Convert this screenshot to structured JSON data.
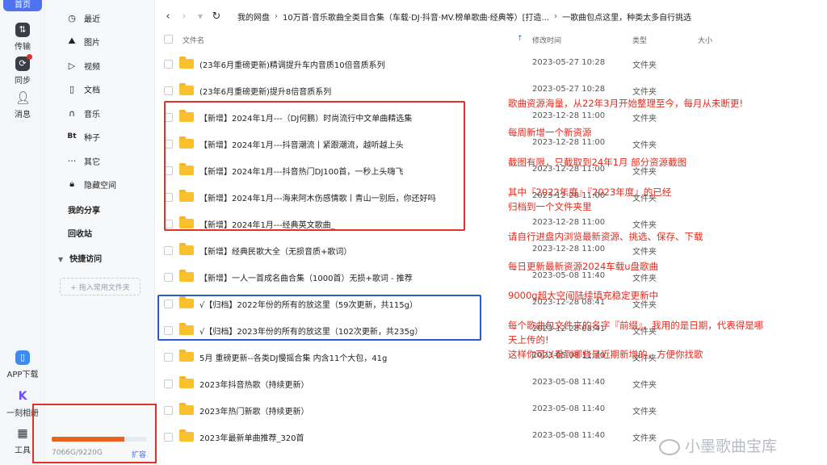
{
  "rail": {
    "home": "首页",
    "transfer": "传输",
    "sync": "同步",
    "messages": "消息",
    "app_download": "APP下载",
    "album": "一刻相册",
    "tools": "工具"
  },
  "nav": {
    "items": [
      {
        "icon": "clock-icon",
        "glyph": "◷",
        "label": "最近"
      },
      {
        "icon": "image-icon",
        "glyph": "⛰",
        "label": "图片"
      },
      {
        "icon": "video-icon",
        "glyph": "▷",
        "label": "视频"
      },
      {
        "icon": "document-icon",
        "glyph": "▯",
        "label": "文档"
      },
      {
        "icon": "headphones-icon",
        "glyph": "∩",
        "label": "音乐"
      },
      {
        "icon": "bt-icon",
        "glyph": "Bt",
        "label": "种子"
      },
      {
        "icon": "more-icon",
        "glyph": "···",
        "label": "其它"
      },
      {
        "icon": "lock-icon",
        "glyph": "🔒︎",
        "label": "隐藏空间"
      }
    ],
    "my_share": "我的分享",
    "recycle": "回收站",
    "quick_access": "快捷访问",
    "add_quick": "+ 拖入常用文件夹",
    "storage_text": "7066G/9220G",
    "storage_fraction": 0.766,
    "expand": "扩容"
  },
  "toolbar": {
    "back": "‹",
    "forward": "›",
    "refresh": "↻",
    "crumbs": [
      "我的网盘",
      "10万首·音乐歌曲全类目合集（车载·DJ·抖音·MV.榜单歌曲·经典等）[打造...",
      "一歌曲包点这里，种类太多自行挑选"
    ]
  },
  "columns": {
    "name": "文件名",
    "modified": "修改时间",
    "type": "类型",
    "size": "大小"
  },
  "rows": [
    {
      "name": "(23年6月重磅更新)精调提升车内音质10倍音质系列",
      "date": "2023-05-27 10:28",
      "type": "文件夹"
    },
    {
      "name": "(23年6月重磅更新)提升8倍音质系列",
      "date": "2023-05-27 10:28",
      "type": "文件夹"
    },
    {
      "name": "【新增】2024年1月---（DJ何鹏）时尚流行中文单曲精选集",
      "date": "2023-12-28 11:00",
      "type": "文件夹"
    },
    {
      "name": "【新增】2024年1月---抖音潮流丨紧跟潮流，越听越上头",
      "date": "2023-12-28 11:00",
      "type": "文件夹"
    },
    {
      "name": "【新增】2024年1月---抖音热门DJ100首，一秒上头嗨飞",
      "date": "2023-12-28 11:00",
      "type": "文件夹"
    },
    {
      "name": "【新增】2024年1月---海来阿木伤感情歌丨青山一别后，你还好吗",
      "date": "2023-12-28 11:00",
      "type": "文件夹"
    },
    {
      "name": "【新增】2024年1月---经典英文歌曲_",
      "date": "2023-12-28 11:00",
      "type": "文件夹"
    },
    {
      "name": "【新增】经典民歌大全（无损音质+歌词）",
      "date": "2023-12-28 11:00",
      "type": "文件夹"
    },
    {
      "name": "【新增】一人一首成名曲合集（1000首）无损+歌词 - 推荐",
      "date": "2023-05-08 11:40",
      "type": "文件夹"
    },
    {
      "name": "√【归档】2022年份的所有的放这里（59次更新，共115g）",
      "date": "2023-12-28 08:41",
      "type": "文件夹"
    },
    {
      "name": "√【归档】2023年份的所有的放这里（102次更新，共235g）",
      "date": "2023-12-28 08:41",
      "type": "文件夹"
    },
    {
      "name": "5月 重磅更新--各类DJ慢摇合集 内含11个大包，41g",
      "date": "2023-05-08 11:40",
      "type": "文件夹"
    },
    {
      "name": "2023年抖音热歌（持续更新）",
      "date": "2023-05-08 11:40",
      "type": "文件夹"
    },
    {
      "name": "2023年热门新歌（持续更新）",
      "date": "2023-05-08 11:40",
      "type": "文件夹"
    },
    {
      "name": "2023年最新单曲推荐_320首",
      "date": "2023-05-08 11:40",
      "type": "文件夹"
    }
  ],
  "annotations": [
    "歌曲资源海量，从22年3月开始整理至今，每月从未断更!",
    "每周新增一个新资源",
    "截图有限，只截取到24年1月 部分资源截图",
    "其中『2022年度』『2023年度』的已经",
    "归档到一个文件夹里",
    "请自行进盘内浏览最新资源、挑选、保存、下载",
    "每日更新最新资源2024车载u盘歌曲",
    "9000g超大空间陆续填充稳定更新中",
    "每个歌曲包文件夹的名字『前缀』，我用的是日期，代表得是哪",
    "天上传的!",
    "这样你可以看到哪些是近期新增的，方便你找歌"
  ],
  "watermark": "小墨歌曲宝库",
  "colors": {
    "accent": "#4e72f0",
    "annotation": "#e22a1e",
    "folder": "#fbc02d",
    "box_blue": "#2a5bd7",
    "storage_fill": "#e9621f"
  }
}
